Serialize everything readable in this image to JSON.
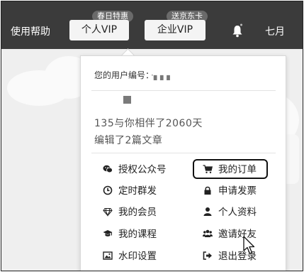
{
  "topbar": {
    "help_label": "使用帮助",
    "personal_vip": {
      "label": "个人VIP",
      "badge": "春日特惠"
    },
    "enterprise_vip": {
      "label": "企业VIP",
      "badge": "送京东卡"
    },
    "notifications_icon": "bell-icon",
    "username": "七月"
  },
  "dropdown": {
    "user_id_label": "您的用户编号：",
    "user_id_value": "·▖▖▖",
    "stat_days": "135与你相伴了2060天",
    "stat_articles": "编辑了2篇文章",
    "menu": {
      "left": [
        {
          "label": "授权公众号",
          "icon": "wechat-icon"
        },
        {
          "label": "定时群发",
          "icon": "clock-icon"
        },
        {
          "label": "我的会员",
          "icon": "diamond-icon"
        },
        {
          "label": "我的课程",
          "icon": "graduation-cap-icon"
        },
        {
          "label": "水印设置",
          "icon": "image-icon"
        }
      ],
      "right": [
        {
          "label": "我的订单",
          "icon": "cart-icon"
        },
        {
          "label": "申请发票",
          "icon": "lock-icon"
        },
        {
          "label": "个人资料",
          "icon": "user-icon"
        },
        {
          "label": "邀请好友",
          "icon": "users-icon"
        },
        {
          "label": "退出登录",
          "icon": "sign-out-icon"
        }
      ]
    }
  },
  "colors": {
    "topbar": "#3b3b3b",
    "highlight_border": "#111111"
  }
}
